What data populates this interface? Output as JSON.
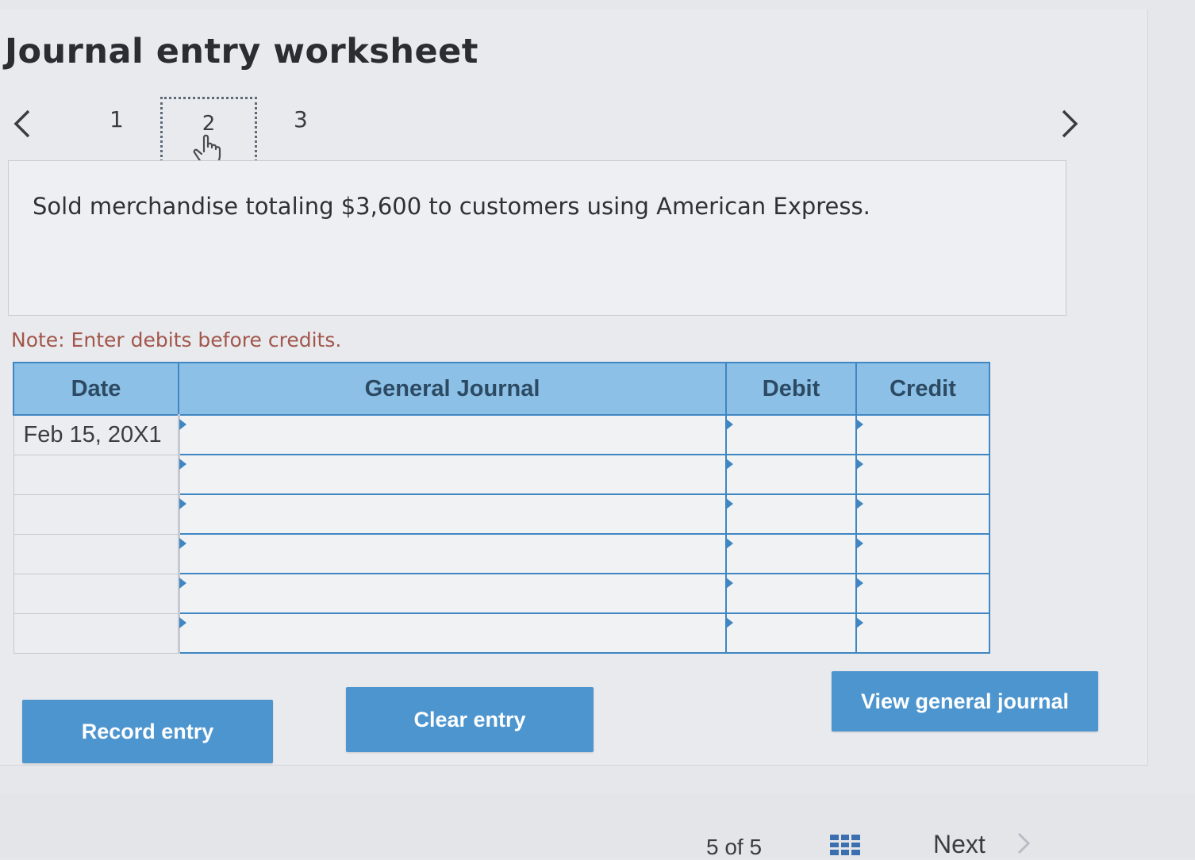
{
  "worksheet": {
    "title": "Journal entry worksheet",
    "steps": [
      "1",
      "2",
      "3"
    ],
    "active_step": "2",
    "description": "Sold merchandise totaling $3,600 to customers using American Express.",
    "note": "Note: Enter debits before credits."
  },
  "journal_table": {
    "headers": {
      "date": "Date",
      "general_journal": "General Journal",
      "debit": "Debit",
      "credit": "Credit"
    },
    "rows": [
      {
        "date": "Feb 15, 20X1",
        "account": "",
        "debit": "",
        "credit": ""
      },
      {
        "date": "",
        "account": "",
        "debit": "",
        "credit": ""
      },
      {
        "date": "",
        "account": "",
        "debit": "",
        "credit": ""
      },
      {
        "date": "",
        "account": "",
        "debit": "",
        "credit": ""
      },
      {
        "date": "",
        "account": "",
        "debit": "",
        "credit": ""
      },
      {
        "date": "",
        "account": "",
        "debit": "",
        "credit": ""
      }
    ]
  },
  "buttons": {
    "record_entry": "Record entry",
    "clear_entry": "Clear entry",
    "view_general_journal": "View general journal"
  },
  "footer": {
    "page_indicator": "5 of 5",
    "next_label": "Next"
  },
  "colors": {
    "accent": "#4d95cf",
    "table_header": "#8cc0e6",
    "table_border": "#3f86c2",
    "note_text": "#a2574c"
  },
  "icons": {
    "prev": "chevron-left-icon",
    "next": "chevron-right-icon",
    "cursor": "hand-pointer-icon",
    "grid": "grid-icon"
  }
}
